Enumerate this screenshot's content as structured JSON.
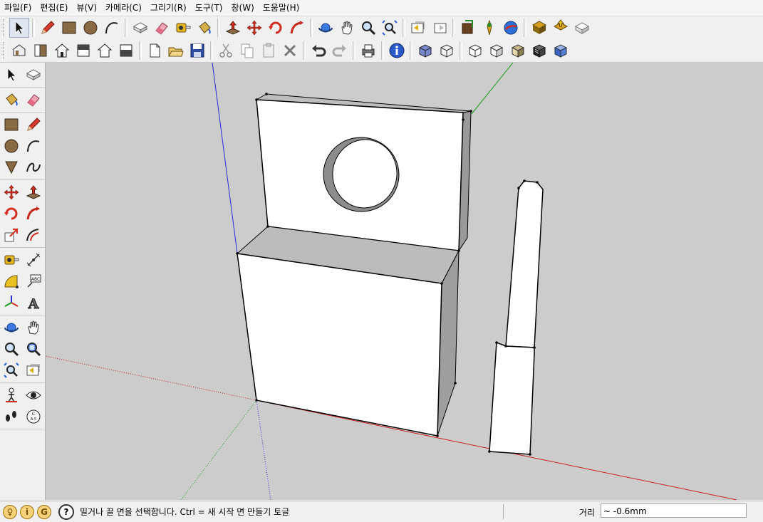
{
  "menu": [
    "파일(F)",
    "편집(E)",
    "뷰(V)",
    "카메라(C)",
    "그리기(R)",
    "도구(T)",
    "창(W)",
    "도움말(H)"
  ],
  "toolbar_row1": [
    {
      "icon": "select-arrow-icon",
      "active": true,
      "group_start": false
    },
    {
      "icon": "pencil-line-icon",
      "group_start": true
    },
    {
      "icon": "rectangle-icon"
    },
    {
      "icon": "circle-icon"
    },
    {
      "icon": "arc-icon"
    },
    {
      "icon": "make-component-icon",
      "group_start": true
    },
    {
      "icon": "eraser-icon"
    },
    {
      "icon": "tape-measure-icon"
    },
    {
      "icon": "paint-bucket-icon"
    },
    {
      "icon": "push-pull-icon",
      "group_start": true
    },
    {
      "icon": "move-icon"
    },
    {
      "icon": "rotate-icon"
    },
    {
      "icon": "follow-me-icon"
    },
    {
      "icon": "orbit-icon",
      "group_start": true
    },
    {
      "icon": "pan-hand-icon"
    },
    {
      "icon": "zoom-icon"
    },
    {
      "icon": "zoom-extents-icon"
    },
    {
      "icon": "previous-view-icon",
      "group_start": true
    },
    {
      "icon": "next-view-icon"
    },
    {
      "icon": "add-location-icon",
      "group_start": true
    },
    {
      "icon": "toggle-terrain-icon"
    },
    {
      "icon": "google-earth-icon"
    },
    {
      "icon": "get-models-icon",
      "group_start": true
    },
    {
      "icon": "share-model-icon"
    },
    {
      "icon": "share-component-icon"
    }
  ],
  "toolbar_row2": [
    {
      "icon": "iso-view-icon"
    },
    {
      "icon": "top-view-icon"
    },
    {
      "icon": "front-view-icon"
    },
    {
      "icon": "right-view-icon"
    },
    {
      "icon": "back-view-icon"
    },
    {
      "icon": "left-view-icon"
    },
    {
      "icon": "new-file-icon",
      "group_start": true
    },
    {
      "icon": "open-folder-icon"
    },
    {
      "icon": "save-disk-icon"
    },
    {
      "icon": "cut-scissors-icon",
      "group_start": true
    },
    {
      "icon": "copy-icon"
    },
    {
      "icon": "paste-icon"
    },
    {
      "icon": "delete-x-icon"
    },
    {
      "icon": "undo-icon",
      "group_start": true
    },
    {
      "icon": "redo-icon"
    },
    {
      "icon": "print-icon",
      "group_start": true
    },
    {
      "icon": "model-info-icon",
      "group_start": true
    },
    {
      "icon": "xray-style-icon",
      "group_start": true
    },
    {
      "icon": "wireframe-style-icon"
    },
    {
      "icon": "hidden-line-style-icon",
      "group_start": true
    },
    {
      "icon": "shaded-style-icon"
    },
    {
      "icon": "shaded-texture-style-icon"
    },
    {
      "icon": "monochrome-style-icon"
    },
    {
      "icon": "xray-blue-style-icon"
    }
  ],
  "left_toolbar": [
    [
      "select-arrow-icon",
      "make-component-icon"
    ],
    [
      "paint-bucket-icon",
      "eraser-icon"
    ],
    [
      "rectangle-icon",
      "pencil-line-icon",
      "circle-icon",
      "arc-icon",
      "polygon-icon",
      "freehand-icon"
    ],
    [
      "move-icon",
      "push-pull-icon",
      "rotate-icon",
      "follow-me-icon",
      "scale-icon",
      "offset-icon"
    ],
    [
      "tape-measure-icon",
      "dimension-icon",
      "protractor-icon",
      "text-label-icon",
      "axes-icon",
      "3d-text-icon"
    ],
    [
      "orbit-icon",
      "pan-hand-icon",
      "zoom-icon",
      "zoom-window-icon",
      "zoom-extents-icon",
      "previous-view-icon"
    ],
    [
      "position-camera-icon",
      "look-around-icon",
      "walk-icon",
      "section-plane-icon"
    ]
  ],
  "status": {
    "message": "밀거나 끌 면을 선택합니다.  Ctrl = 새 시작 면 만들기 토글",
    "measure_label": "거리",
    "measure_value": "~ -0.6mm"
  }
}
